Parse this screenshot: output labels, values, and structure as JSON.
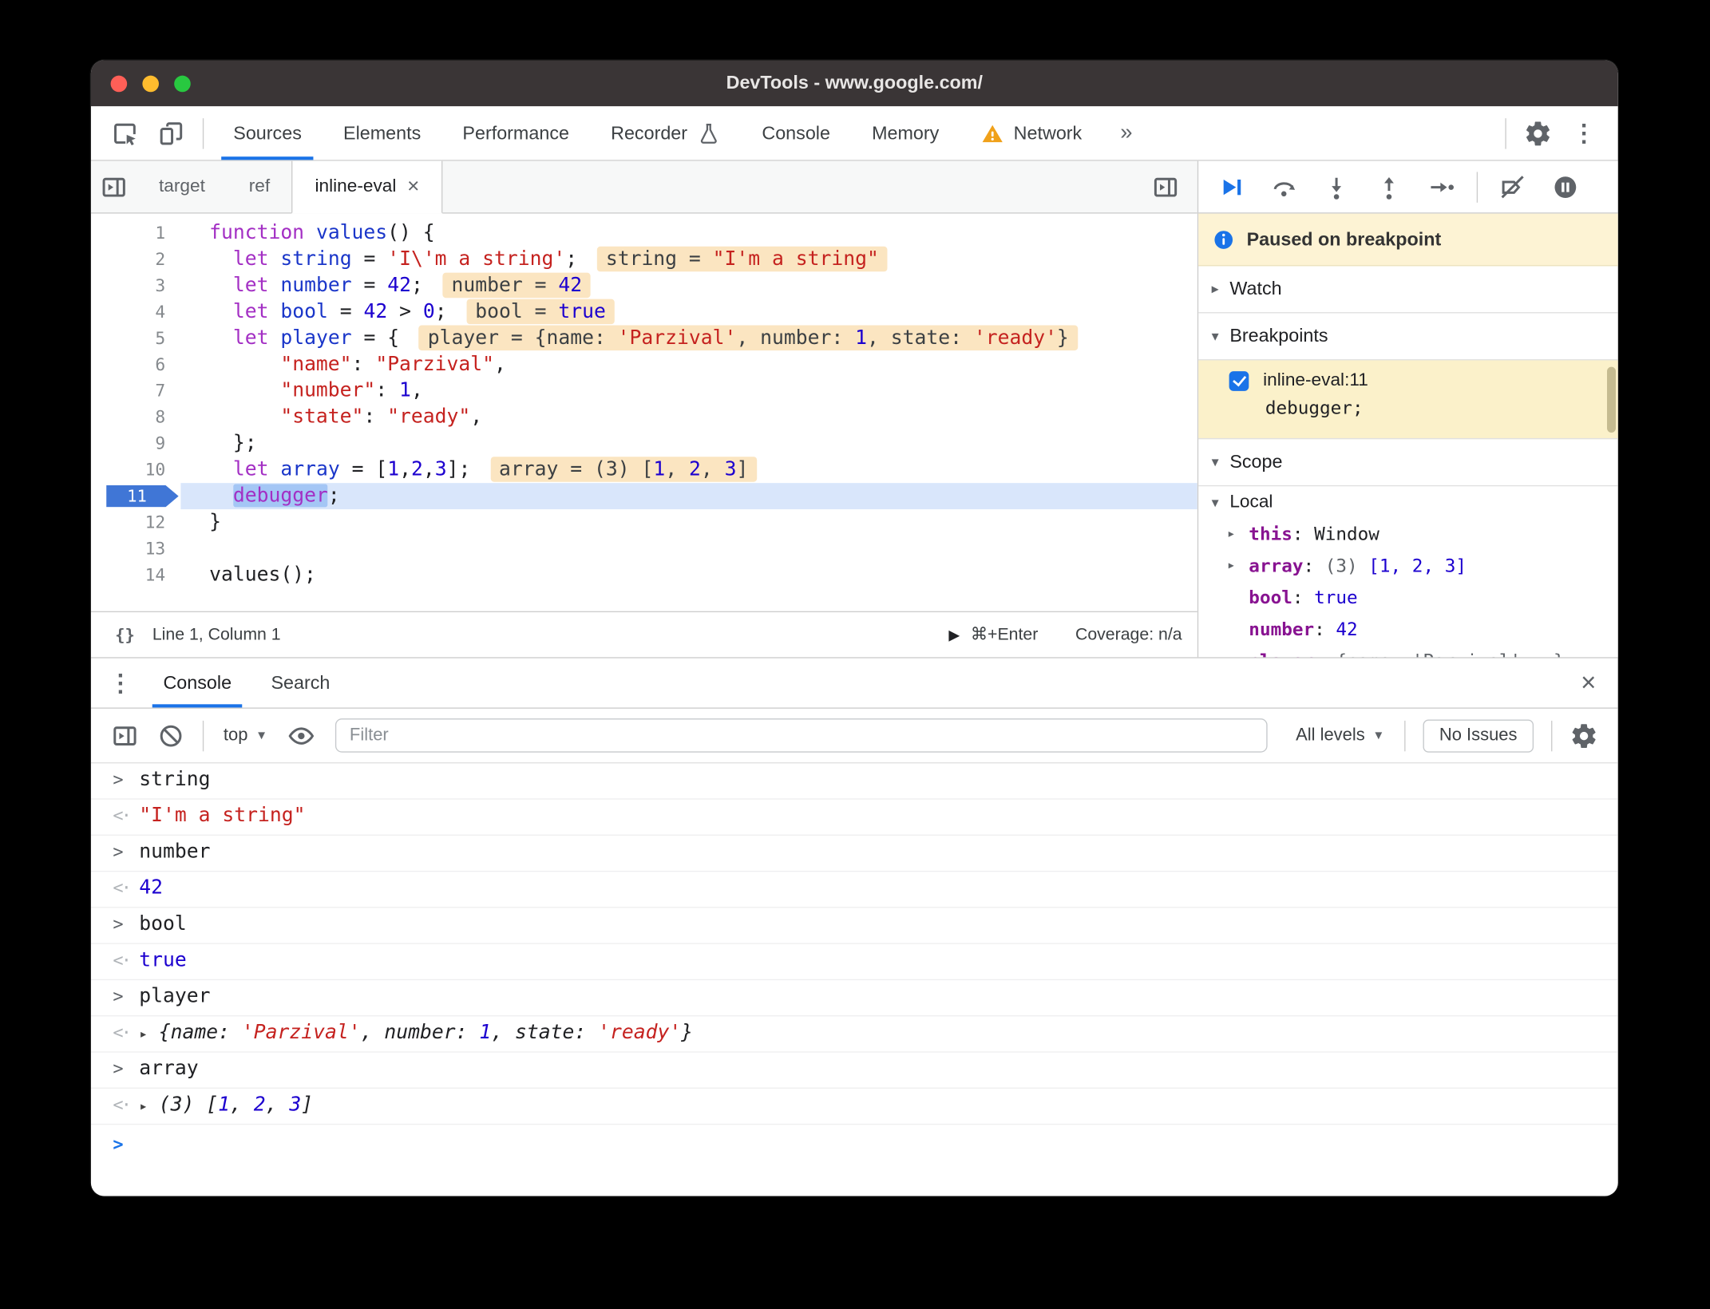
{
  "colors": {
    "accent_blue": "#1a73e8",
    "titlebar_bg": "#3a3536",
    "traffic_lights": [
      "#ff5f57",
      "#febc2e",
      "#28c840"
    ],
    "keyword": "#a32fc4",
    "string": "#c5221f",
    "number": "#1c00cf",
    "variable": "#1a36c9",
    "property": "#881391",
    "eval_badge_bg": "#fbe5c1",
    "current_line_bg": "#d9e6fb",
    "paused_banner_bg": "#fdf3d4",
    "breakpoint_entry_bg": "#fbf1ca",
    "warning_yellow": "#f0a11a"
  },
  "icons": {
    "inspect-icon": "cursor in box",
    "device-toolbar-icon": "phone and screen",
    "warning-icon": "⚠",
    "flask-icon": "experiment flask",
    "settings-gear-icon": "⚙",
    "kebab-menu-icon": "⋮",
    "toggle-panel-icon": "▶| in box",
    "resume-icon": "▶|",
    "step-over-icon": "arc arrow over dot",
    "step-into-icon": "↓ to dot",
    "step-out-icon": "↑ from dot",
    "step-icon": "→ to dot",
    "deactivate-breakpoints-icon": "breakpoint tag with slash",
    "pause-on-exceptions-icon": "⏸ in circle",
    "info-icon": "ⓘ",
    "clear-console-icon": "⊘",
    "eye-icon": "👁",
    "close-icon": "×",
    "pretty-print-icon": "{}",
    "run-icon": "▶",
    "dropdown-chevron-icon": "▼",
    "expand-triangle-icon": "▸",
    "collapse-triangle-icon": "▾"
  },
  "titlebar": {
    "title": "DevTools - www.google.com/"
  },
  "toolbar": {
    "tabs": [
      {
        "label": "Sources",
        "active": true
      },
      {
        "label": "Elements"
      },
      {
        "label": "Performance"
      },
      {
        "label": "Recorder",
        "trailing_icon": "flask-icon"
      },
      {
        "label": "Console"
      },
      {
        "label": "Memory"
      },
      {
        "label": "Network",
        "warning": true
      }
    ],
    "overflow_chevron": "»"
  },
  "file_tabs": [
    {
      "label": "target"
    },
    {
      "label": "ref"
    },
    {
      "label": "inline-eval",
      "active": true,
      "close": "×"
    }
  ],
  "editor": {
    "current_line": 11,
    "lines": [
      [
        {
          "c": "kw",
          "t": "function"
        },
        {
          "c": "pl",
          "t": " "
        },
        {
          "c": "def",
          "t": "values"
        },
        {
          "c": "pl",
          "t": "() {"
        }
      ],
      [
        {
          "c": "pl",
          "t": "  "
        },
        {
          "c": "kw",
          "t": "let"
        },
        {
          "c": "pl",
          "t": " "
        },
        {
          "c": "vr",
          "t": "string"
        },
        {
          "c": "pl",
          "t": " = "
        },
        {
          "c": "str",
          "t": "'I\\'m a string'"
        },
        {
          "c": "pl",
          "t": ";"
        },
        {
          "badge": [
            {
              "c": "bpl",
              "t": "string = "
            },
            {
              "c": "str",
              "t": "\"I'm a string\""
            }
          ]
        }
      ],
      [
        {
          "c": "pl",
          "t": "  "
        },
        {
          "c": "kw",
          "t": "let"
        },
        {
          "c": "pl",
          "t": " "
        },
        {
          "c": "vr",
          "t": "number"
        },
        {
          "c": "pl",
          "t": " = "
        },
        {
          "c": "num",
          "t": "42"
        },
        {
          "c": "pl",
          "t": ";"
        },
        {
          "badge": [
            {
              "c": "bpl",
              "t": "number = "
            },
            {
              "c": "num",
              "t": "42"
            }
          ]
        }
      ],
      [
        {
          "c": "pl",
          "t": "  "
        },
        {
          "c": "kw",
          "t": "let"
        },
        {
          "c": "pl",
          "t": " "
        },
        {
          "c": "vr",
          "t": "bool"
        },
        {
          "c": "pl",
          "t": " = "
        },
        {
          "c": "num",
          "t": "42"
        },
        {
          "c": "pl",
          "t": " > "
        },
        {
          "c": "num",
          "t": "0"
        },
        {
          "c": "pl",
          "t": ";"
        },
        {
          "badge": [
            {
              "c": "bpl",
              "t": "bool = "
            },
            {
              "c": "num",
              "t": "true"
            }
          ]
        }
      ],
      [
        {
          "c": "pl",
          "t": "  "
        },
        {
          "c": "kw",
          "t": "let"
        },
        {
          "c": "pl",
          "t": " "
        },
        {
          "c": "vr",
          "t": "player"
        },
        {
          "c": "pl",
          "t": " = {"
        },
        {
          "badge": [
            {
              "c": "bpl",
              "t": "player = {name: "
            },
            {
              "c": "str",
              "t": "'Parzival'"
            },
            {
              "c": "bpl",
              "t": ", number: "
            },
            {
              "c": "num",
              "t": "1"
            },
            {
              "c": "bpl",
              "t": ", state: "
            },
            {
              "c": "str",
              "t": "'ready'"
            },
            {
              "c": "bpl",
              "t": "}"
            }
          ]
        }
      ],
      [
        {
          "c": "pl",
          "t": "      "
        },
        {
          "c": "str",
          "t": "\"name\""
        },
        {
          "c": "pl",
          "t": ": "
        },
        {
          "c": "str",
          "t": "\"Parzival\""
        },
        {
          "c": "pl",
          "t": ","
        }
      ],
      [
        {
          "c": "pl",
          "t": "      "
        },
        {
          "c": "str",
          "t": "\"number\""
        },
        {
          "c": "pl",
          "t": ": "
        },
        {
          "c": "num",
          "t": "1"
        },
        {
          "c": "pl",
          "t": ","
        }
      ],
      [
        {
          "c": "pl",
          "t": "      "
        },
        {
          "c": "str",
          "t": "\"state\""
        },
        {
          "c": "pl",
          "t": ": "
        },
        {
          "c": "str",
          "t": "\"ready\""
        },
        {
          "c": "pl",
          "t": ","
        }
      ],
      [
        {
          "c": "pl",
          "t": "  };"
        }
      ],
      [
        {
          "c": "pl",
          "t": "  "
        },
        {
          "c": "kw",
          "t": "let"
        },
        {
          "c": "pl",
          "t": " "
        },
        {
          "c": "vr",
          "t": "array"
        },
        {
          "c": "pl",
          "t": " = ["
        },
        {
          "c": "num",
          "t": "1"
        },
        {
          "c": "pl",
          "t": ","
        },
        {
          "c": "num",
          "t": "2"
        },
        {
          "c": "pl",
          "t": ","
        },
        {
          "c": "num",
          "t": "3"
        },
        {
          "c": "pl",
          "t": "];"
        },
        {
          "badge": [
            {
              "c": "bpl",
              "t": "array = (3) ["
            },
            {
              "c": "num",
              "t": "1"
            },
            {
              "c": "bpl",
              "t": ", "
            },
            {
              "c": "num",
              "t": "2"
            },
            {
              "c": "bpl",
              "t": ", "
            },
            {
              "c": "num",
              "t": "3"
            },
            {
              "c": "bpl",
              "t": "]"
            }
          ]
        }
      ],
      [
        {
          "c": "pl",
          "t": "  "
        },
        {
          "c": "kw sel",
          "t": "debugger"
        },
        {
          "c": "pl",
          "t": ";"
        }
      ],
      [
        {
          "c": "pl",
          "t": "}"
        }
      ],
      [],
      [
        {
          "c": "pl",
          "t": "values();"
        }
      ]
    ]
  },
  "status_bar": {
    "pretty_print": "{}",
    "position": "Line 1, Column 1",
    "run_shortcut": "⌘+Enter",
    "coverage": "Coverage: n/a"
  },
  "debugger": {
    "paused_message": "Paused on breakpoint",
    "watch_label": "Watch",
    "breakpoints_label": "Breakpoints",
    "breakpoint": {
      "file": "inline-eval:11",
      "code": "debugger;",
      "checked": true
    },
    "scope_label": "Scope",
    "scope_group": "Local",
    "scope_entries": [
      {
        "expand": true,
        "segs": [
          {
            "c": "name",
            "t": "this"
          },
          {
            "c": "pl",
            "t": ": "
          },
          {
            "c": "val",
            "t": "Window"
          }
        ]
      },
      {
        "expand": true,
        "segs": [
          {
            "c": "name",
            "t": "array"
          },
          {
            "c": "pl",
            "t": ": "
          },
          {
            "c": "dim",
            "t": "(3) "
          },
          {
            "c": "num",
            "t": "[1, 2, 3]"
          }
        ]
      },
      {
        "segs": [
          {
            "c": "name",
            "t": "bool"
          },
          {
            "c": "pl",
            "t": ": "
          },
          {
            "c": "num",
            "t": "true"
          }
        ]
      },
      {
        "segs": [
          {
            "c": "name",
            "t": "number"
          },
          {
            "c": "pl",
            "t": ": "
          },
          {
            "c": "num",
            "t": "42"
          }
        ]
      },
      {
        "expand": true,
        "segs": [
          {
            "c": "name",
            "t": "player"
          },
          {
            "c": "pl",
            "t": ": "
          },
          {
            "c": "dim",
            "t": "{name: 'Parzival', …}"
          }
        ]
      }
    ]
  },
  "console": {
    "tabs": [
      {
        "label": "Console",
        "active": true
      },
      {
        "label": "Search"
      }
    ],
    "close": "×",
    "toolbar": {
      "context": "top",
      "filter_placeholder": "Filter",
      "levels": "All levels",
      "issues": "No Issues"
    },
    "entries": [
      {
        "type": "input",
        "segs": [
          {
            "c": "pl",
            "t": "string"
          }
        ]
      },
      {
        "type": "result",
        "segs": [
          {
            "c": "str",
            "t": "\"I'm a string\""
          }
        ]
      },
      {
        "type": "input",
        "segs": [
          {
            "c": "pl",
            "t": "number"
          }
        ]
      },
      {
        "type": "result",
        "segs": [
          {
            "c": "num",
            "t": "42"
          }
        ]
      },
      {
        "type": "input",
        "segs": [
          {
            "c": "pl",
            "t": "bool"
          }
        ]
      },
      {
        "type": "result",
        "segs": [
          {
            "c": "num",
            "t": "true"
          }
        ]
      },
      {
        "type": "input",
        "segs": [
          {
            "c": "pl",
            "t": "player"
          }
        ]
      },
      {
        "type": "result",
        "expand": true,
        "italic": true,
        "segs": [
          {
            "c": "obj",
            "t": "{"
          },
          {
            "c": "key",
            "t": "name"
          },
          {
            "c": "obj",
            "t": ": "
          },
          {
            "c": "str",
            "t": "'Parzival'"
          },
          {
            "c": "obj",
            "t": ", "
          },
          {
            "c": "key",
            "t": "number"
          },
          {
            "c": "obj",
            "t": ": "
          },
          {
            "c": "num",
            "t": "1"
          },
          {
            "c": "obj",
            "t": ", "
          },
          {
            "c": "key",
            "t": "state"
          },
          {
            "c": "obj",
            "t": ": "
          },
          {
            "c": "str",
            "t": "'ready'"
          },
          {
            "c": "obj",
            "t": "}"
          }
        ]
      },
      {
        "type": "input",
        "segs": [
          {
            "c": "pl",
            "t": "array"
          }
        ]
      },
      {
        "type": "result",
        "expand": true,
        "italic": true,
        "segs": [
          {
            "c": "obj",
            "t": "(3) ["
          },
          {
            "c": "num",
            "t": "1"
          },
          {
            "c": "obj",
            "t": ", "
          },
          {
            "c": "num",
            "t": "2"
          },
          {
            "c": "obj",
            "t": ", "
          },
          {
            "c": "num",
            "t": "3"
          },
          {
            "c": "obj",
            "t": "]"
          }
        ]
      },
      {
        "type": "prompt"
      }
    ]
  }
}
